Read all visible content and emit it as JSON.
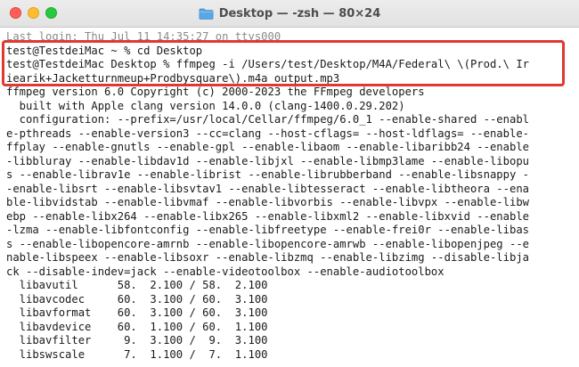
{
  "window": {
    "title": "Desktop — -zsh — 80×24"
  },
  "terminal": {
    "lines": [
      "Last login: Thu Jul 11 14:35:27 on ttys000",
      "test@TestdeiMac ~ % cd Desktop",
      "test@TestdeiMac Desktop % ffmpeg -i /Users/test/Desktop/M4A/Federal\\ \\(Prod.\\ Ir",
      "iearik+Jacketturnmeup+Prodbysquare\\).m4a output.mp3",
      "ffmpeg version 6.0 Copyright (c) 2000-2023 the FFmpeg developers",
      "  built with Apple clang version 14.0.0 (clang-1400.0.29.202)",
      "  configuration: --prefix=/usr/local/Cellar/ffmpeg/6.0_1 --enable-shared --enabl",
      "e-pthreads --enable-version3 --cc=clang --host-cflags= --host-ldflags= --enable-",
      "ffplay --enable-gnutls --enable-gpl --enable-libaom --enable-libaribb24 --enable",
      "-libbluray --enable-libdav1d --enable-libjxl --enable-libmp3lame --enable-libopu",
      "s --enable-librav1e --enable-librist --enable-librubberband --enable-libsnappy -",
      "-enable-libsrt --enable-libsvtav1 --enable-libtesseract --enable-libtheora --ena",
      "ble-libvidstab --enable-libvmaf --enable-libvorbis --enable-libvpx --enable-libw",
      "ebp --enable-libx264 --enable-libx265 --enable-libxml2 --enable-libxvid --enable",
      "-lzma --enable-libfontconfig --enable-libfreetype --enable-frei0r --enable-libas",
      "s --enable-libopencore-amrnb --enable-libopencore-amrwb --enable-libopenjpeg --e",
      "nable-libspeex --enable-libsoxr --enable-libzmq --enable-libzimg --disable-libja",
      "ck --disable-indev=jack --enable-videotoolbox --enable-audiotoolbox",
      "  libavutil      58.  2.100 / 58.  2.100",
      "  libavcodec     60.  3.100 / 60.  3.100",
      "  libavformat    60.  3.100 / 60.  3.100",
      "  libavdevice    60.  1.100 / 60.  1.100",
      "  libavfilter     9.  3.100 /  9.  3.100",
      "  libswscale      7.  1.100 /  7.  1.100"
    ]
  },
  "colors": {
    "highlight_border": "#e0392f",
    "text": "#1a1a1a"
  },
  "icons": {
    "title_icon": "folder-icon"
  }
}
